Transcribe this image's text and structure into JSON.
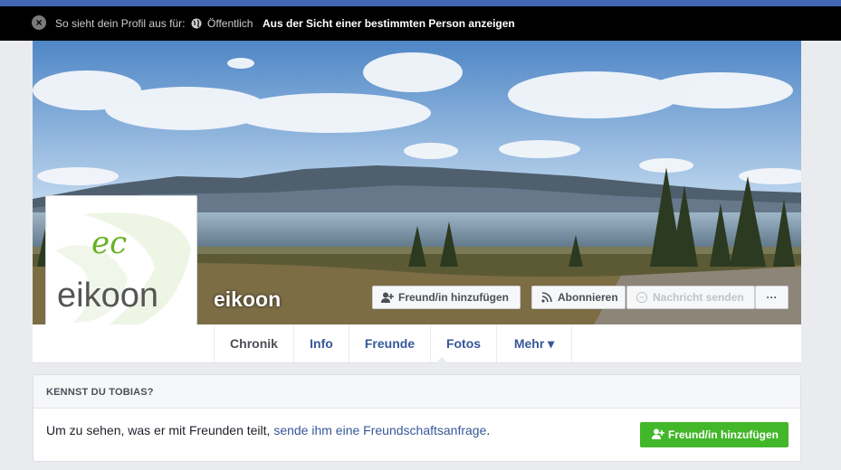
{
  "viewbar": {
    "close_icon": "close-icon",
    "label": "So sieht dein Profil aus für:",
    "audience_icon": "globe-icon",
    "audience": "Öffentlich",
    "view_as_link": "Aus der Sicht einer bestimmten Person anzeigen"
  },
  "profile": {
    "name": "eikoon",
    "logo_text": "eikoon",
    "logo_color": "#6ab023"
  },
  "actions": {
    "add_friend": "Freund/in hinzufügen",
    "subscribe": "Abonnieren",
    "message": "Nachricht senden",
    "more": "···"
  },
  "tabs": [
    {
      "label": "Chronik"
    },
    {
      "label": "Info"
    },
    {
      "label": "Freunde"
    },
    {
      "label": "Fotos"
    },
    {
      "label": "Mehr ▾"
    }
  ],
  "suggestion": {
    "heading": "KENNST DU TOBIAS?",
    "text_before": "Um zu sehen, was er mit Freunden teilt, ",
    "link_text": "sende ihm eine Freundschaftsanfrage",
    "text_after": ".",
    "button": "Freund/in hinzufügen"
  },
  "colors": {
    "brand_blue": "#4267b2",
    "link": "#365899",
    "green": "#42b72a"
  }
}
